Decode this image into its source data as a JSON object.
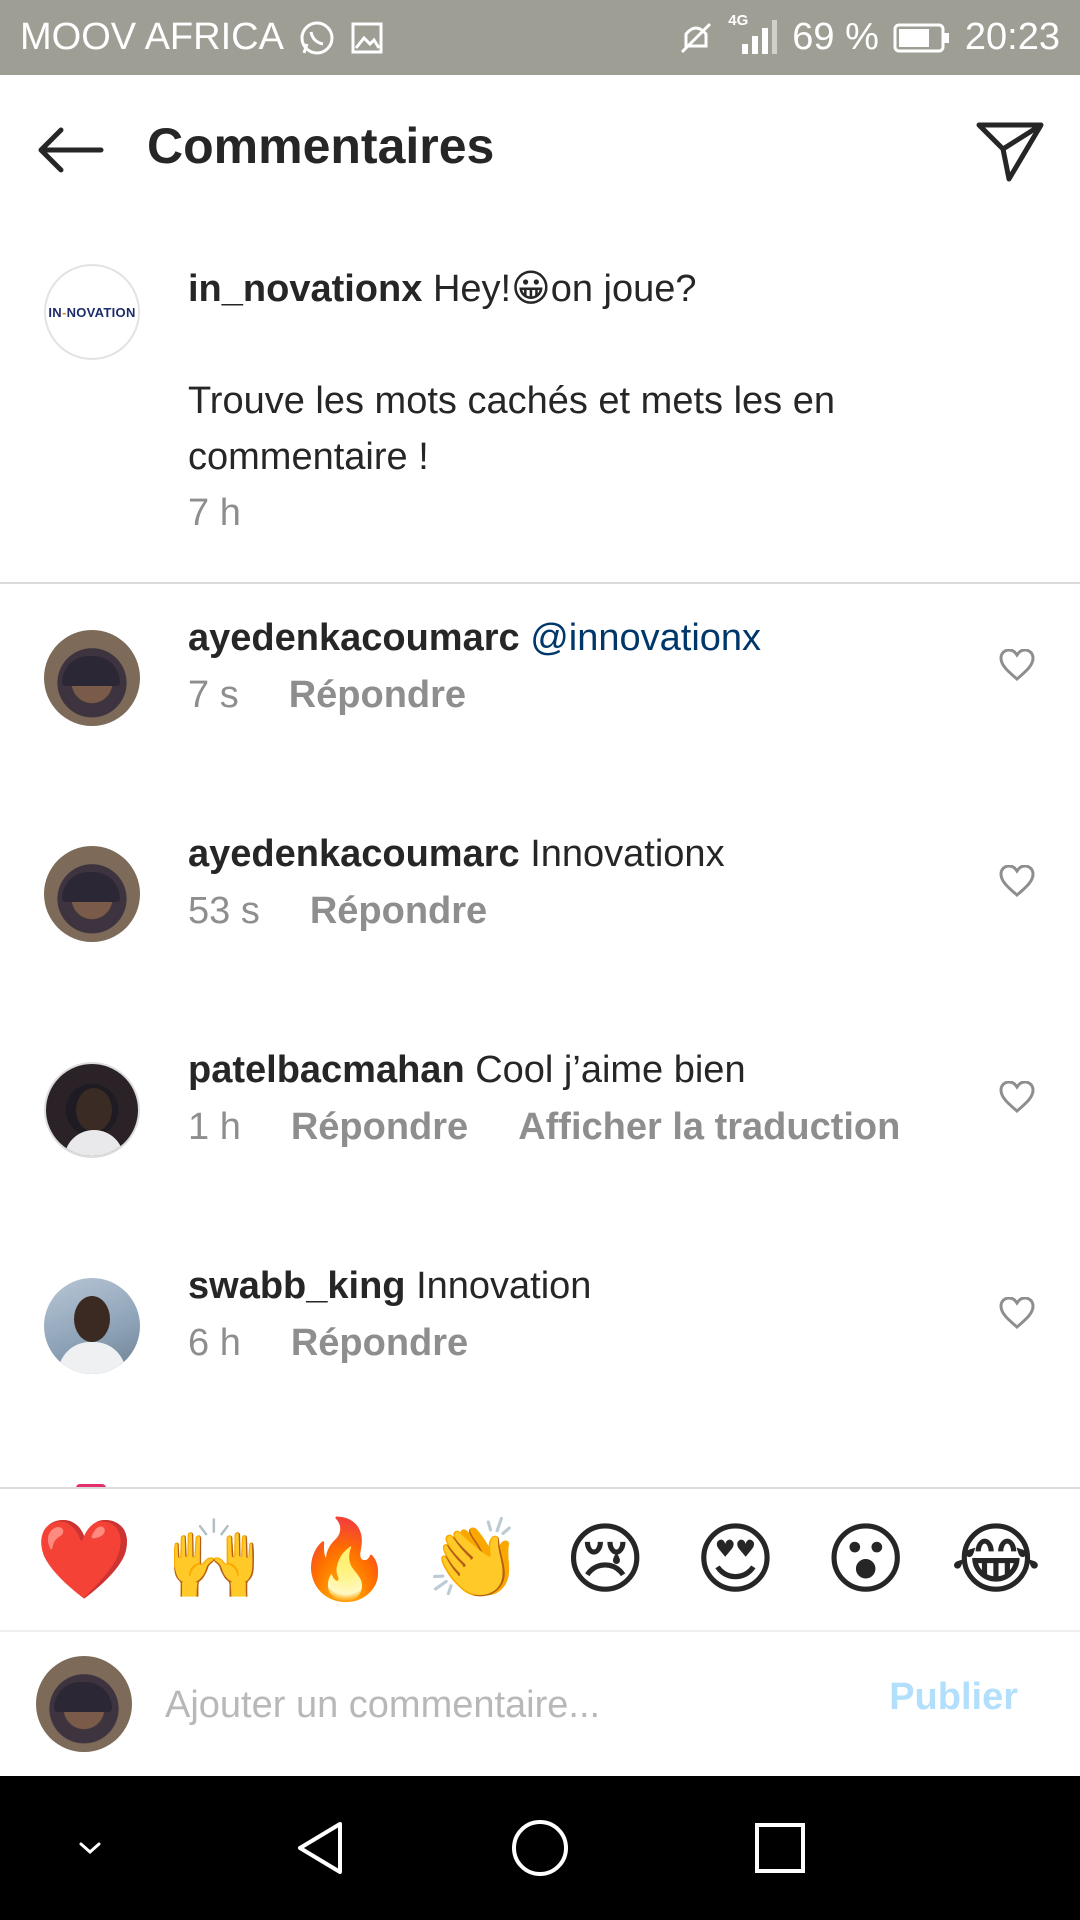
{
  "status_bar": {
    "carrier": "MOOV AFRICA",
    "network": "4G",
    "battery": "69 %",
    "time": "20:23",
    "icons": [
      "whatsapp-icon",
      "gallery-icon",
      "mute-icon",
      "signal-icon",
      "battery-icon"
    ]
  },
  "header": {
    "title": "Commentaires",
    "back_icon": "arrow-left-icon",
    "share_icon": "send-icon"
  },
  "caption": {
    "username": "in_novationx",
    "text_line1_before": "Hey!",
    "emoji": "😀",
    "text_line1_after": "on joue?",
    "text_paragraph": "Trouve les mots cachés et mets les en commentaire !",
    "time": "7 h",
    "avatar_logo": {
      "part1": "IN",
      "part2": "NOVATION"
    }
  },
  "comments": [
    {
      "username": "ayedenkacoumarc",
      "mention": "@innovationx",
      "text": "",
      "time": "7 s",
      "reply_label": "Répondre",
      "translate_label": ""
    },
    {
      "username": "ayedenkacoumarc",
      "mention": "",
      "text": "Innovationx",
      "time": "53 s",
      "reply_label": "Répondre",
      "translate_label": ""
    },
    {
      "username": "patelbacmahan",
      "mention": "",
      "text": "Cool j’aime bien",
      "time": "1 h",
      "reply_label": "Répondre",
      "translate_label": "Afficher la traduction"
    },
    {
      "username": "swabb_king",
      "mention": "",
      "text": "Innovation",
      "time": "6 h",
      "reply_label": "Répondre",
      "translate_label": ""
    }
  ],
  "reactions": [
    "❤️",
    "🙌",
    "🔥",
    "👏",
    "😢",
    "😍",
    "😮",
    "😂"
  ],
  "composer": {
    "placeholder": "Ajouter un commentaire...",
    "publish_label": "Publier"
  },
  "colors": {
    "status_bar_bg": "#9e9e95",
    "mention": "#00376b",
    "meta_gray": "#8e8e8e",
    "publish_disabled": "#b2dffc"
  }
}
